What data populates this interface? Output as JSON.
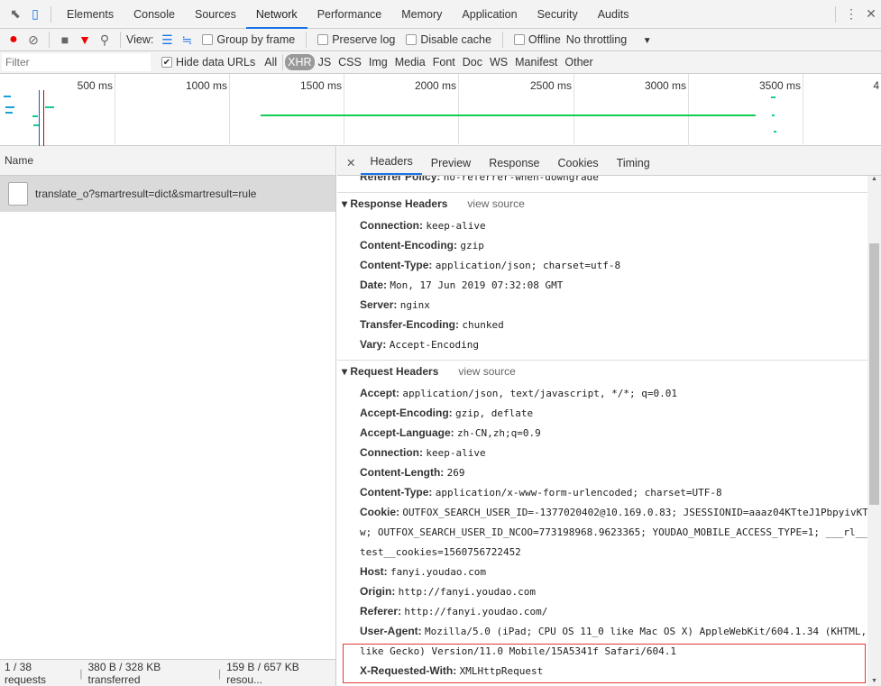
{
  "tabs": [
    "Elements",
    "Console",
    "Sources",
    "Network",
    "Performance",
    "Memory",
    "Application",
    "Security",
    "Audits"
  ],
  "toolbar": {
    "view_label": "View:",
    "group_by_frame": "Group by frame",
    "preserve_log": "Preserve log",
    "disable_cache": "Disable cache",
    "offline": "Offline",
    "throttling": "No throttling"
  },
  "filter": {
    "placeholder": "Filter",
    "hide_data_urls": "Hide data URLs",
    "types": [
      "All",
      "XHR",
      "JS",
      "CSS",
      "Img",
      "Media",
      "Font",
      "Doc",
      "WS",
      "Manifest",
      "Other"
    ]
  },
  "overview": {
    "ticks": [
      "500 ms",
      "1000 ms",
      "1500 ms",
      "2000 ms",
      "2500 ms",
      "3000 ms",
      "3500 ms",
      "4"
    ]
  },
  "list": {
    "header": "Name",
    "request": "translate_o?smartresult=dict&smartresult=rule"
  },
  "status": {
    "requests": "1 / 38 requests",
    "transferred": "380 B / 328 KB transferred",
    "resources": "159 B / 657 KB resou..."
  },
  "detail": {
    "tabs": [
      "Headers",
      "Preview",
      "Response",
      "Cookies",
      "Timing"
    ],
    "referrer_policy": {
      "k": "Referrer Policy:",
      "v": "no-referrer-when-downgrade"
    },
    "response_title": "Response Headers",
    "request_title": "Request Headers",
    "view_source": "view source",
    "response": [
      {
        "k": "Connection:",
        "v": "keep-alive"
      },
      {
        "k": "Content-Encoding:",
        "v": "gzip"
      },
      {
        "k": "Content-Type:",
        "v": "application/json; charset=utf-8"
      },
      {
        "k": "Date:",
        "v": "Mon, 17 Jun 2019 07:32:08 GMT"
      },
      {
        "k": "Server:",
        "v": "nginx"
      },
      {
        "k": "Transfer-Encoding:",
        "v": "chunked"
      },
      {
        "k": "Vary:",
        "v": "Accept-Encoding"
      }
    ],
    "request": [
      {
        "k": "Accept:",
        "v": "application/json, text/javascript, */*; q=0.01"
      },
      {
        "k": "Accept-Encoding:",
        "v": "gzip, deflate"
      },
      {
        "k": "Accept-Language:",
        "v": "zh-CN,zh;q=0.9"
      },
      {
        "k": "Connection:",
        "v": "keep-alive"
      },
      {
        "k": "Content-Length:",
        "v": "269"
      },
      {
        "k": "Content-Type:",
        "v": "application/x-www-form-urlencoded; charset=UTF-8"
      },
      {
        "k": "Cookie:",
        "v": "OUTFOX_SEARCH_USER_ID=-1377020402@10.169.0.83; JSESSIONID=aaaz04KTteJ1PbpyivKT",
        "v2": "w; OUTFOX_SEARCH_USER_ID_NCOO=773198968.9623365; YOUDAO_MOBILE_ACCESS_TYPE=1; ___rl__",
        "v3": "test__cookies=1560756722452"
      },
      {
        "k": "Host:",
        "v": "fanyi.youdao.com"
      },
      {
        "k": "Origin:",
        "v": "http://fanyi.youdao.com"
      },
      {
        "k": "Referer:",
        "v": "http://fanyi.youdao.com/"
      },
      {
        "k": "User-Agent:",
        "v": "Mozilla/5.0 (iPad; CPU OS 11_0 like Mac OS X) AppleWebKit/604.1.34 (KHTML,",
        "v2": "like Gecko) Version/11.0 Mobile/15A5341f Safari/604.1"
      },
      {
        "k": "X-Requested-With:",
        "v": "XMLHttpRequest"
      }
    ]
  }
}
